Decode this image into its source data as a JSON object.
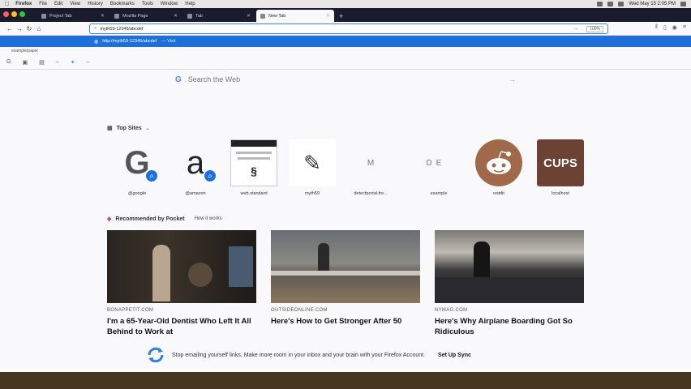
{
  "menubar": {
    "items": [
      "Firefox",
      "File",
      "Edit",
      "View",
      "History",
      "Bookmarks",
      "Tools",
      "Window",
      "Help"
    ],
    "clock": "Wed May 15 2:05 PM"
  },
  "tabs": [
    {
      "label": "Project Tab",
      "active": false
    },
    {
      "label": "Mozilla Page",
      "active": false
    },
    {
      "label": "Tab",
      "active": false
    },
    {
      "label": "New Tab",
      "active": true
    }
  ],
  "urlbar": {
    "value": "myth59-12345/abcdef",
    "zoom": "100%"
  },
  "suggestion": {
    "url": "http://myth59-12345/abcdef",
    "action": "— Visit"
  },
  "bookmarks_line": "example/paper",
  "search": {
    "placeholder": "Search the Web"
  },
  "top_sites": {
    "heading": "Top Sites",
    "items": [
      {
        "label": "@google"
      },
      {
        "label": "@amazon"
      },
      {
        "label": "web.standard"
      },
      {
        "label": "myth59"
      },
      {
        "label": "detectportal.fre...",
        "letter": "M"
      },
      {
        "label": "",
        "letter": "D"
      },
      {
        "label": "example",
        "letter": "E"
      },
      {
        "label": "reddit"
      },
      {
        "label": "localhost",
        "text": "CUPS"
      }
    ]
  },
  "pocket": {
    "heading": "Recommended by Pocket",
    "how_link": "How it works",
    "stories": [
      {
        "source": "BONAPPETIT.COM",
        "title": "I'm a 65-Year-Old Dentist Who Left It All Behind to Work at"
      },
      {
        "source": "OUTSIDEONLINE.COM",
        "title": "Here's How to Get Stronger After 50"
      },
      {
        "source": "NYMAG.COM",
        "title": "Here's Why Airplane Boarding Got So Ridiculous"
      }
    ]
  },
  "sync": {
    "message": "Stop emailing yourself links. Make more room in your inbox and your brain with your Firefox Account.",
    "cta": "Set Up Sync"
  },
  "colors": {
    "accent": "#1f6fd8",
    "tabbar": "#1b1b2e",
    "page": "#f9f9fb"
  }
}
